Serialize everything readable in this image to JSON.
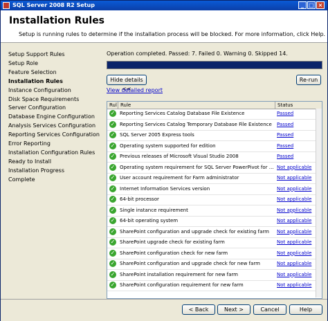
{
  "window": {
    "title": "SQL Server 2008 R2 Setup"
  },
  "header": {
    "title": "Installation Rules",
    "subtitle": "Setup is running rules to determine if the installation process will be blocked. For more information, click Help."
  },
  "steps": [
    "Setup Support Rules",
    "Setup Role",
    "Feature Selection",
    "Installation Rules",
    "Instance Configuration",
    "Disk Space Requirements",
    "Server Configuration",
    "Database Engine Configuration",
    "Analysis Services Configuration",
    "Reporting Services Configuration",
    "Error Reporting",
    "Installation Configuration Rules",
    "Ready to Install",
    "Installation Progress",
    "Complete"
  ],
  "active_step": "Installation Rules",
  "status_text": "Operation completed. Passed: 7.   Failed 0.   Warning 0.   Skipped 14.",
  "progress": 1.0,
  "buttons": {
    "hide_details": "Hide details <<",
    "rerun": "Re-run",
    "view_report": "View detailed report",
    "back": "< Back",
    "next": "Next >",
    "cancel": "Cancel",
    "help": "Help"
  },
  "table": {
    "columns": [
      "Rul",
      "Rule",
      "Status"
    ],
    "rows": [
      {
        "rule": "Reporting Services Catalog Database File Existence",
        "status": "Passed"
      },
      {
        "rule": "Reporting Services Catalog Temporary Database File Existence",
        "status": "Passed"
      },
      {
        "rule": "SQL Server 2005 Express tools",
        "status": "Passed"
      },
      {
        "rule": "Operating system supported for edition",
        "status": "Passed"
      },
      {
        "rule": "Previous releases of Microsoft Visual Studio 2008",
        "status": "Passed"
      },
      {
        "rule": "Operating system requirement for SQL Server PowerPivot for Share...",
        "status": "Not applicable"
      },
      {
        "rule": "User account requirement for Farm administrator",
        "status": "Not applicable"
      },
      {
        "rule": "Internet Information Services version",
        "status": "Not applicable"
      },
      {
        "rule": "64-bit processor",
        "status": "Not applicable"
      },
      {
        "rule": "Single instance requirement",
        "status": "Not applicable"
      },
      {
        "rule": "64-bit operating system",
        "status": "Not applicable"
      },
      {
        "rule": "SharePoint configuration and upgrade check for existing farm",
        "status": "Not applicable"
      },
      {
        "rule": "SharePoint upgrade check for existing farm",
        "status": "Not applicable"
      },
      {
        "rule": "SharePoint configuration check for new farm",
        "status": "Not applicable"
      },
      {
        "rule": "SharePoint configuration and upgrade check for new farm",
        "status": "Not applicable"
      },
      {
        "rule": "SharePoint installation requirement for new farm",
        "status": "Not applicable"
      },
      {
        "rule": "SharePoint configuration requirement for new farm",
        "status": "Not applicable"
      }
    ]
  },
  "colors": {
    "titlebar": "#0b3fa8",
    "progress": "#0a246a",
    "pass_icon": "#3aa62f",
    "link": "#0000cc"
  },
  "icons": {
    "row_status": "check-circle-icon",
    "app": "sql-server-icon"
  }
}
